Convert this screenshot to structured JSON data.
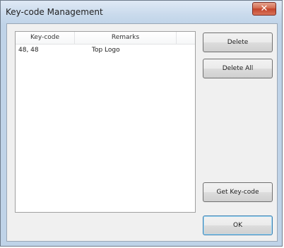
{
  "window": {
    "title": "Key-code Management",
    "close_symbol": "✕",
    "close_icon": "close-icon"
  },
  "list": {
    "columns": [
      "Key-code",
      "Remarks"
    ],
    "rows": [
      {
        "keycode": "48, 48",
        "remarks": "Top Logo"
      }
    ]
  },
  "buttons": {
    "delete": "Delete",
    "delete_all": "Delete All",
    "get_keycode": "Get Key-code",
    "ok": "OK"
  },
  "colors": {
    "close_button": "#c2432a",
    "ok_focus_border": "#3c7fb1"
  }
}
